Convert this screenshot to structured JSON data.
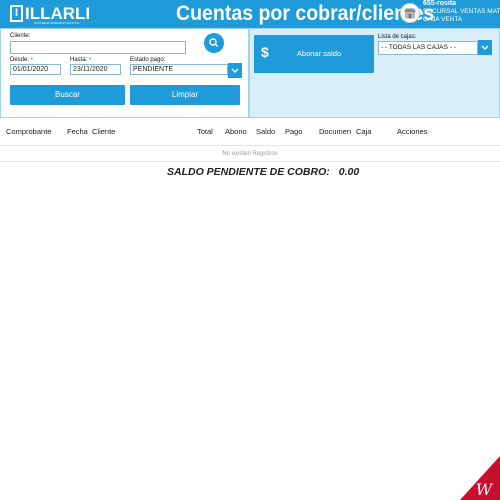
{
  "header": {
    "logo_text": "ILLARLI",
    "logo_initial": "I",
    "logo_subtitle": "SISTEMA ADMINISTRATIVO",
    "title": "Cuentas por cobrar/clientes",
    "user": {
      "name": "655-rosita",
      "branch": "SUCURSAL VENTAS MAT",
      "register": "CAJA VENTA"
    }
  },
  "filters": {
    "cliente_label": "Cliente:",
    "cliente_value": "",
    "desde_label": "Desde:",
    "desde_value": "01/01/2020",
    "hasta_label": "Hasta:",
    "hasta_value": "23/11/2020",
    "estado_label": "Estado pago:",
    "estado_value": "PENDIENTE",
    "buscar_label": "Buscar",
    "limpiar_label": "Limpiar"
  },
  "actions": {
    "abonar_icon": "$",
    "abonar_label": "Abonar saldo",
    "cajas_label": "Lista de cajas:",
    "cajas_value": "- - TODAS LAS CAJAS - -"
  },
  "table": {
    "columns": [
      "Comprobante",
      "Fecha",
      "Cliente",
      "Total",
      "Abono",
      "Saldo",
      "Pago",
      "Documen",
      "Caja",
      "Acciones"
    ],
    "empty_message": "No existen Registros"
  },
  "summary": {
    "label": "SALDO PENDIENTE DE COBRO:",
    "value": "0.00"
  },
  "colors": {
    "accent": "#1e9bd8",
    "panel": "#d8eef8"
  }
}
